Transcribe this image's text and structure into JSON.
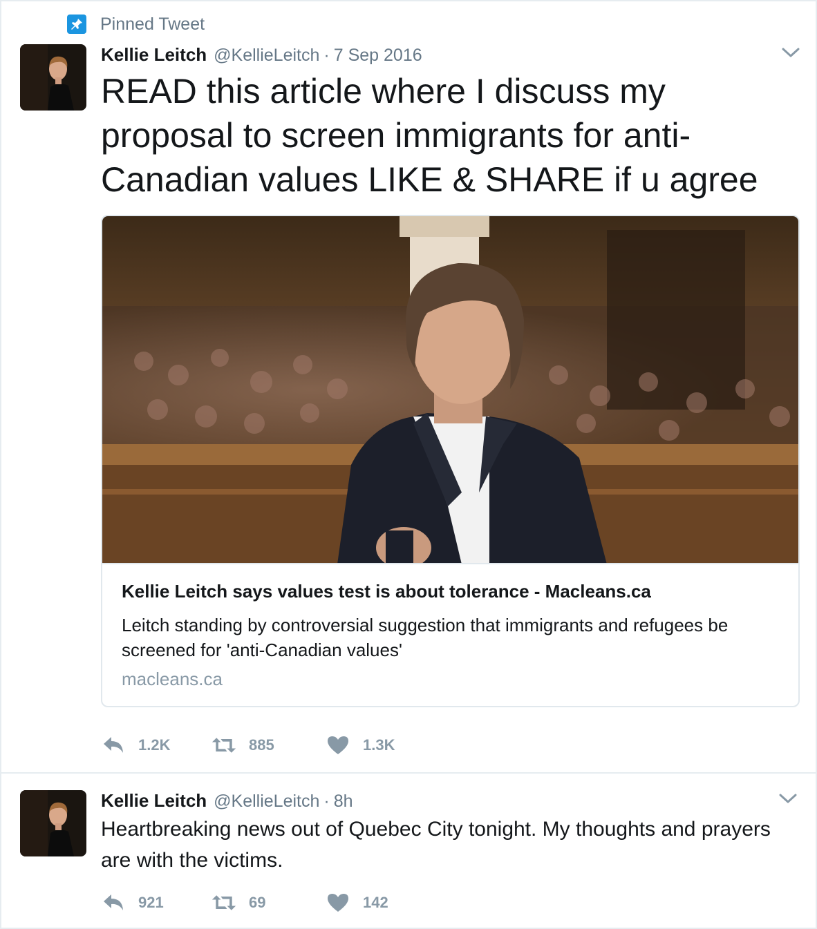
{
  "pinned_label": "Pinned Tweet",
  "colors": {
    "accent": "#1b95e0",
    "text": "#14171a",
    "muted": "#657786",
    "icon": "#8899a6",
    "border": "#e6ecf0"
  },
  "tweets": [
    {
      "fullname": "Kellie Leitch",
      "username": "@KellieLeitch",
      "separator": "·",
      "time": "7 Sep 2016",
      "text": "READ this article where I discuss my proposal to screen immigrants for anti-Canadian values LIKE & SHARE if u agree",
      "card": {
        "title": "Kellie Leitch says values test is about tolerance - Macleans.ca",
        "description": "Leitch standing by controversial suggestion that immigrants and refugees be screened for 'anti-Canadian values'",
        "domain": "macleans.ca"
      },
      "reply_count": "1.2K",
      "retweet_count": "885",
      "like_count": "1.3K",
      "icons": {
        "reply": "reply-icon",
        "retweet": "retweet-icon",
        "like": "heart-icon",
        "more": "chevron-down-icon"
      }
    },
    {
      "fullname": "Kellie Leitch",
      "username": "@KellieLeitch",
      "separator": "·",
      "time": "8h",
      "text": "Heartbreaking news out of Quebec City tonight. My thoughts and prayers are with the victims.",
      "reply_count": "921",
      "retweet_count": "69",
      "like_count": "142",
      "icons": {
        "reply": "reply-icon",
        "retweet": "retweet-icon",
        "like": "heart-icon",
        "more": "chevron-down-icon"
      }
    }
  ]
}
